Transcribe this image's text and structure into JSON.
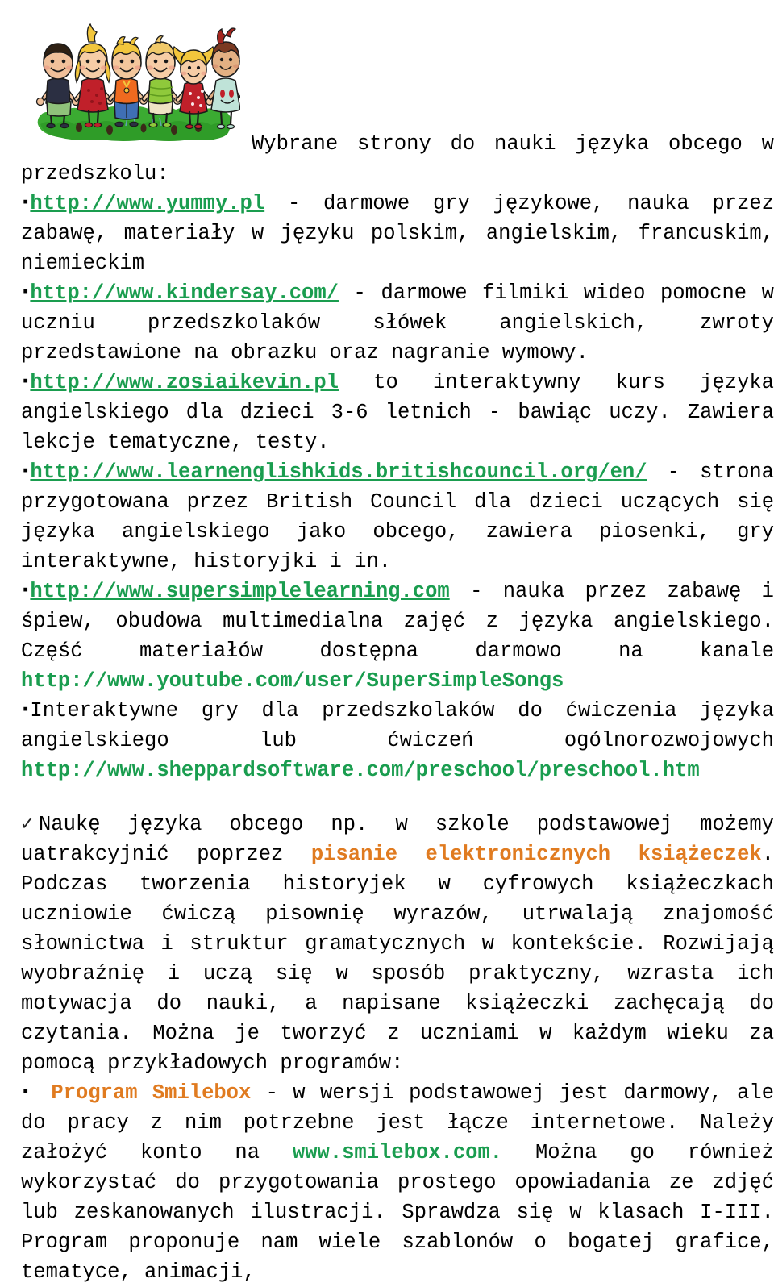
{
  "document": {
    "title_line": "Wybrane strony do nauki języka obcego w przedszkolu:",
    "image": {
      "alt": "six-children-holding-hands-on-grass-clipart",
      "name": "children-clipart"
    },
    "links_section": {
      "bullet_glyph": "▪",
      "items": [
        {
          "url": "http://www.yummy.pl",
          "url_style": "green-bold-underline",
          "description": " - darmowe gry językowe, nauka przez zabawę, materiały w języku polskim, angielskim, francuskim, niemieckim"
        },
        {
          "url": "http://www.kindersay.com/",
          "url_style": "green-bold-underline",
          "description": " - darmowe filmiki wideo pomocne w uczniu przedszkolaków słówek angielskich, zwroty przedstawione na obrazku oraz nagranie wymowy."
        },
        {
          "url": "http://www.zosiaikevin.pl",
          "url_style": "green-bold-underline",
          "description": " to interaktywny kurs języka angielskiego dla dzieci 3-6 letnich - bawiąc uczy. Zawiera lekcje tematyczne, testy."
        },
        {
          "url": "http://www.learnenglishkids.britishcouncil.org/en/",
          "url_style": "green-bold-underline",
          "description": " - strona przygotowana przez British Council dla dzieci uczących się języka angielskiego jako obcego, zawiera piosenki, gry interaktywne, historyjki i in."
        },
        {
          "url": "http://www.supersimplelearning.com",
          "url_style": "green-bold-underline",
          "description": " - nauka przez zabawę i śpiew, obudowa multimedialna zajęć z języka angielskiego. Część materiałów dostępna darmowo na kanale ",
          "trailing_url": "http://www.youtube.com/user/SuperSimpleSongs",
          "trailing_url_style": "green-bold-plain"
        },
        {
          "text_before": "Interaktywne gry dla przedszkolaków do ćwiczenia języka angielskiego lub ćwiczeń ogólnorozwojowych ",
          "trailing_url": "http://www.sheppardsoftware.com/preschool/preschool.htm",
          "trailing_url_style": "green-bold-plain"
        }
      ]
    },
    "check_section": {
      "check_glyph": "✓",
      "part1": "Naukę języka obcego  np. w szkole podstawowej możemy uatrakcyjnić poprzez ",
      "highlight": "pisanie  elektronicznych  książeczek",
      "part2": ". Podczas tworzenia historyjek w cyfrowych książeczkach uczniowie ćwiczą pisownię wyrazów, utrwalają znajomość słownictwa i struktur gramatycznych w kontekście. Rozwijają wyobraźnię i uczą się w sposób praktyczny, wzrasta ich motywacja do nauki, a napisane książeczki zachęcają do czytania. Można je tworzyć z uczniami w każdym wieku za pomocą przykładowych programów:"
    },
    "program_section": {
      "bullet_glyph": "▪",
      "name_highlight": "Program Smilebox",
      "part1": " - w wersji podstawowej jest darmowy, ale do pracy z nim potrzebne jest łącze internetowe. Należy założyć konto na ",
      "inline_link": "www.smilebox.com.",
      "inline_link_style": "green-bold-plain",
      "part2": " Można go również wykorzystać do przygotowania prostego opowiadania ze zdjęć lub zeskanowanych ilustracji. Sprawdza się w klasach I-III. Program proponuje nam wiele szablonów o bogatej grafice, tematyce, animacji,"
    },
    "colors": {
      "link_green": "#1a9d4f",
      "highlight_orange": "#e07b20",
      "text_black": "#1f1f1f",
      "page_background": "#ffffff"
    }
  }
}
